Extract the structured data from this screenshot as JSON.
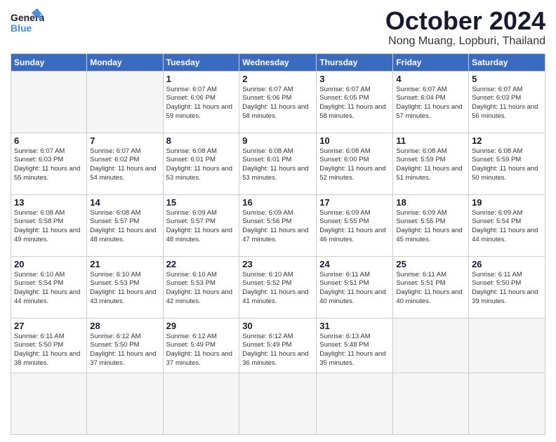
{
  "logo": {
    "general": "General",
    "blue": "Blue"
  },
  "header": {
    "month": "October 2024",
    "location": "Nong Muang, Lopburi, Thailand"
  },
  "weekdays": [
    "Sunday",
    "Monday",
    "Tuesday",
    "Wednesday",
    "Thursday",
    "Friday",
    "Saturday"
  ],
  "days": [
    {
      "num": "",
      "info": ""
    },
    {
      "num": "",
      "info": ""
    },
    {
      "num": "1",
      "info": "Sunrise: 6:07 AM\nSunset: 6:06 PM\nDaylight: 11 hours\nand 59 minutes."
    },
    {
      "num": "2",
      "info": "Sunrise: 6:07 AM\nSunset: 6:06 PM\nDaylight: 11 hours\nand 58 minutes."
    },
    {
      "num": "3",
      "info": "Sunrise: 6:07 AM\nSunset: 6:05 PM\nDaylight: 11 hours\nand 58 minutes."
    },
    {
      "num": "4",
      "info": "Sunrise: 6:07 AM\nSunset: 6:04 PM\nDaylight: 11 hours\nand 57 minutes."
    },
    {
      "num": "5",
      "info": "Sunrise: 6:07 AM\nSunset: 6:03 PM\nDaylight: 11 hours\nand 56 minutes."
    },
    {
      "num": "6",
      "info": "Sunrise: 6:07 AM\nSunset: 6:03 PM\nDaylight: 11 hours\nand 55 minutes."
    },
    {
      "num": "7",
      "info": "Sunrise: 6:07 AM\nSunset: 6:02 PM\nDaylight: 11 hours\nand 54 minutes."
    },
    {
      "num": "8",
      "info": "Sunrise: 6:08 AM\nSunset: 6:01 PM\nDaylight: 11 hours\nand 53 minutes."
    },
    {
      "num": "9",
      "info": "Sunrise: 6:08 AM\nSunset: 6:01 PM\nDaylight: 11 hours\nand 53 minutes."
    },
    {
      "num": "10",
      "info": "Sunrise: 6:08 AM\nSunset: 6:00 PM\nDaylight: 11 hours\nand 52 minutes."
    },
    {
      "num": "11",
      "info": "Sunrise: 6:08 AM\nSunset: 5:59 PM\nDaylight: 11 hours\nand 51 minutes."
    },
    {
      "num": "12",
      "info": "Sunrise: 6:08 AM\nSunset: 5:59 PM\nDaylight: 11 hours\nand 50 minutes."
    },
    {
      "num": "13",
      "info": "Sunrise: 6:08 AM\nSunset: 5:58 PM\nDaylight: 11 hours\nand 49 minutes."
    },
    {
      "num": "14",
      "info": "Sunrise: 6:08 AM\nSunset: 5:57 PM\nDaylight: 11 hours\nand 48 minutes."
    },
    {
      "num": "15",
      "info": "Sunrise: 6:09 AM\nSunset: 5:57 PM\nDaylight: 11 hours\nand 48 minutes."
    },
    {
      "num": "16",
      "info": "Sunrise: 6:09 AM\nSunset: 5:56 PM\nDaylight: 11 hours\nand 47 minutes."
    },
    {
      "num": "17",
      "info": "Sunrise: 6:09 AM\nSunset: 5:55 PM\nDaylight: 11 hours\nand 46 minutes."
    },
    {
      "num": "18",
      "info": "Sunrise: 6:09 AM\nSunset: 5:55 PM\nDaylight: 11 hours\nand 45 minutes."
    },
    {
      "num": "19",
      "info": "Sunrise: 6:09 AM\nSunset: 5:54 PM\nDaylight: 11 hours\nand 44 minutes."
    },
    {
      "num": "20",
      "info": "Sunrise: 6:10 AM\nSunset: 5:54 PM\nDaylight: 11 hours\nand 44 minutes."
    },
    {
      "num": "21",
      "info": "Sunrise: 6:10 AM\nSunset: 5:53 PM\nDaylight: 11 hours\nand 43 minutes."
    },
    {
      "num": "22",
      "info": "Sunrise: 6:10 AM\nSunset: 5:53 PM\nDaylight: 11 hours\nand 42 minutes."
    },
    {
      "num": "23",
      "info": "Sunrise: 6:10 AM\nSunset: 5:52 PM\nDaylight: 11 hours\nand 41 minutes."
    },
    {
      "num": "24",
      "info": "Sunrise: 6:11 AM\nSunset: 5:51 PM\nDaylight: 11 hours\nand 40 minutes."
    },
    {
      "num": "25",
      "info": "Sunrise: 6:11 AM\nSunset: 5:51 PM\nDaylight: 11 hours\nand 40 minutes."
    },
    {
      "num": "26",
      "info": "Sunrise: 6:11 AM\nSunset: 5:50 PM\nDaylight: 11 hours\nand 39 minutes."
    },
    {
      "num": "27",
      "info": "Sunrise: 6:11 AM\nSunset: 5:50 PM\nDaylight: 11 hours\nand 38 minutes."
    },
    {
      "num": "28",
      "info": "Sunrise: 6:12 AM\nSunset: 5:50 PM\nDaylight: 11 hours\nand 37 minutes."
    },
    {
      "num": "29",
      "info": "Sunrise: 6:12 AM\nSunset: 5:49 PM\nDaylight: 11 hours\nand 37 minutes."
    },
    {
      "num": "30",
      "info": "Sunrise: 6:12 AM\nSunset: 5:49 PM\nDaylight: 11 hours\nand 36 minutes."
    },
    {
      "num": "31",
      "info": "Sunrise: 6:13 AM\nSunset: 5:48 PM\nDaylight: 11 hours\nand 35 minutes."
    },
    {
      "num": "",
      "info": ""
    },
    {
      "num": "",
      "info": ""
    },
    {
      "num": "",
      "info": ""
    }
  ]
}
